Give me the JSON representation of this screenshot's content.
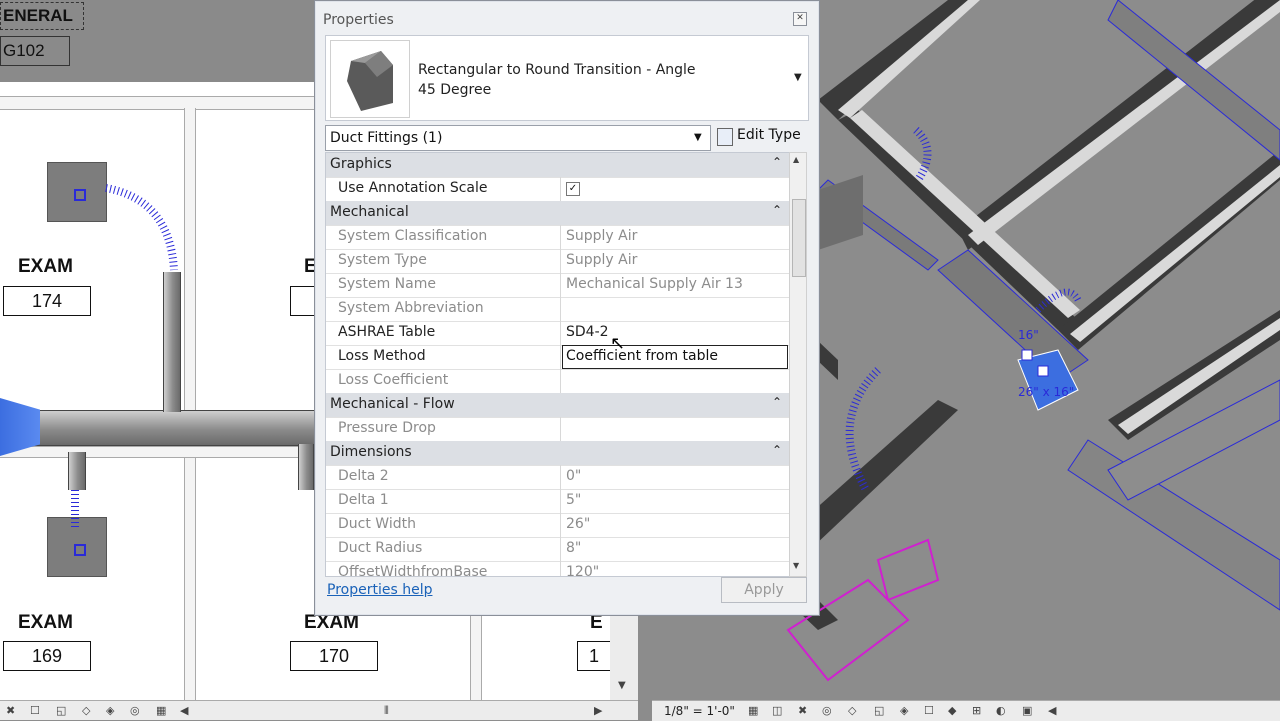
{
  "plan": {
    "header_sheet_title": "ENERAL",
    "header_sheet_number": "G102",
    "rooms": [
      {
        "name": "EXAM",
        "number": "174"
      },
      {
        "name": "E",
        "number": ""
      },
      {
        "name": "EXAM",
        "number": "169"
      },
      {
        "name": "EXAM",
        "number": "170"
      },
      {
        "name": "E",
        "number": "1"
      }
    ]
  },
  "view3d": {
    "duct_tag_1": "16\"",
    "duct_tag_2": "26\" x 16\"",
    "scale": "1/8\" = 1'-0\""
  },
  "properties": {
    "title": "Properties",
    "close_icon": "close-icon",
    "type_name": "Rectangular to Round Transition - Angle",
    "type_variant": "45 Degree",
    "filter_label": "Duct Fittings (1)",
    "edit_type_label": "Edit Type",
    "help_link": "Properties help",
    "apply_label": "Apply",
    "groups": {
      "graphics": "Graphics",
      "mechanical": "Mechanical",
      "mechanical_flow": "Mechanical - Flow",
      "dimensions": "Dimensions"
    },
    "rows": {
      "use_annotation_scale": {
        "label": "Use Annotation Scale",
        "value": "✓"
      },
      "system_classification": {
        "label": "System Classification",
        "value": "Supply Air"
      },
      "system_type": {
        "label": "System Type",
        "value": "Supply Air"
      },
      "system_name": {
        "label": "System Name",
        "value": "Mechanical Supply Air 13"
      },
      "system_abbreviation": {
        "label": "System Abbreviation",
        "value": ""
      },
      "ashrae_table": {
        "label": "ASHRAE Table",
        "value": "SD4-2"
      },
      "loss_method": {
        "label": "Loss Method",
        "value": "Coefficient from table"
      },
      "loss_coefficient": {
        "label": "Loss Coefficient",
        "value": ""
      },
      "pressure_drop": {
        "label": "Pressure Drop",
        "value": ""
      },
      "delta_2": {
        "label": "Delta 2",
        "value": "0\""
      },
      "delta_1": {
        "label": "Delta 1",
        "value": "5\""
      },
      "duct_width": {
        "label": "Duct Width",
        "value": "26\""
      },
      "duct_radius": {
        "label": "Duct Radius",
        "value": "8\""
      },
      "offset_width": {
        "label": "OffsetWidthfromBase",
        "value": "120\""
      }
    }
  },
  "colors": {
    "duct_blue": "#2a2ad8",
    "magenta": "#d020d0",
    "link": "#1a62b8"
  }
}
